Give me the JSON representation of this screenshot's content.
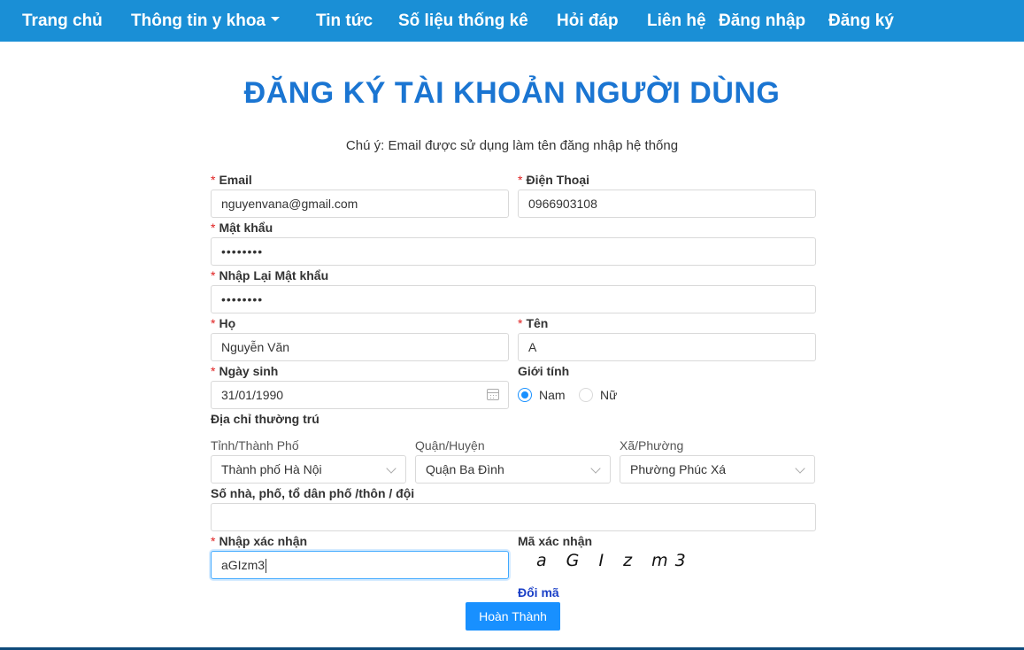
{
  "nav": {
    "home": "Trang chủ",
    "medical_info": "Thông tin y khoa",
    "news": "Tin tức",
    "statistics": "Số liệu thống kê",
    "qa": "Hỏi đáp",
    "contact": "Liên hệ",
    "login": "Đăng nhập",
    "register": "Đăng ký"
  },
  "page": {
    "title": "ĐĂNG KÝ TÀI KHOẢN NGƯỜI DÙNG",
    "notice": "Chú ý: Email được sử dụng làm tên đăng nhập hệ thống",
    "required_mark": "*"
  },
  "form": {
    "email": {
      "label": "Email",
      "value": "nguyenvana@gmail.com"
    },
    "phone": {
      "label": "Điện Thoại",
      "value": "0966903108"
    },
    "password": {
      "label": "Mật khẩu",
      "value": "••••••••"
    },
    "confirm_password": {
      "label": "Nhập Lại Mật khẩu",
      "value": "••••••••"
    },
    "last_name": {
      "label": "Họ",
      "value": "Nguyễn Văn"
    },
    "first_name": {
      "label": "Tên",
      "value": "A"
    },
    "birthday": {
      "label": "Ngày sinh",
      "value": "31/01/1990"
    },
    "gender": {
      "label": "Giới tính",
      "male": "Nam",
      "female": "Nữ",
      "selected": "Nam"
    },
    "address": {
      "label": "Địa chỉ thường trú",
      "province": {
        "label": "Tỉnh/Thành Phố",
        "value": "Thành phố Hà Nội"
      },
      "district": {
        "label": "Quận/Huyện",
        "value": "Quận Ba Đình"
      },
      "ward": {
        "label": "Xã/Phường",
        "value": "Phường Phúc Xá"
      },
      "street": {
        "label": "Số nhà, phố, tổ dân phố /thôn / đội",
        "value": ""
      }
    },
    "captcha_input": {
      "label": "Nhập xác nhận",
      "value": "aGIzm3"
    },
    "captcha": {
      "label": "Mã xác nhận",
      "code": "a G I z m3",
      "refresh": "Đổi mã"
    },
    "submit": "Hoàn Thành"
  }
}
